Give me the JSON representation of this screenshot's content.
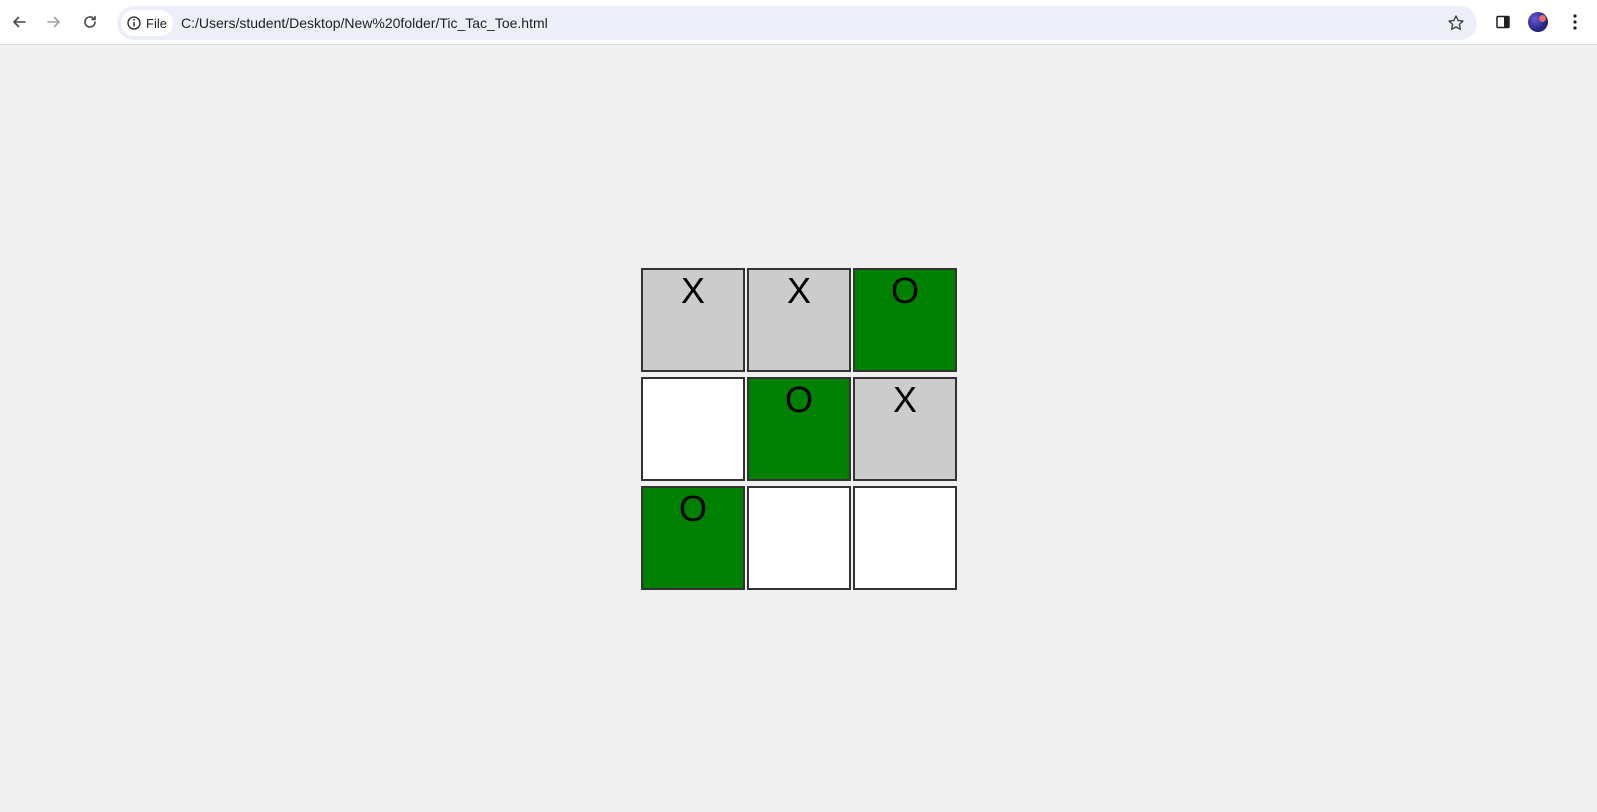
{
  "browser": {
    "site_chip_label": "File",
    "url": "C:/Users/student/Desktop/New%20folder/Tic_Tac_Toe.html",
    "icons": {
      "back": "arrow-left-icon",
      "forward": "arrow-right-icon",
      "reload": "reload-icon",
      "site_info": "info-icon",
      "bookmark": "star-icon",
      "side_panel": "side-panel-icon",
      "profile": "avatar",
      "menu": "kebab-menu-icon"
    }
  },
  "colors": {
    "x_cell": "#cccccc",
    "o_cell": "#008000",
    "empty_cell": "#ffffff",
    "page_background": "#f0f0f0"
  },
  "board": {
    "cells": [
      {
        "mark": "X",
        "state": "x"
      },
      {
        "mark": "X",
        "state": "x"
      },
      {
        "mark": "O",
        "state": "o"
      },
      {
        "mark": "",
        "state": "empty"
      },
      {
        "mark": "O",
        "state": "o"
      },
      {
        "mark": "X",
        "state": "x"
      },
      {
        "mark": "O",
        "state": "o"
      },
      {
        "mark": "",
        "state": "empty"
      },
      {
        "mark": "",
        "state": "empty"
      }
    ]
  }
}
